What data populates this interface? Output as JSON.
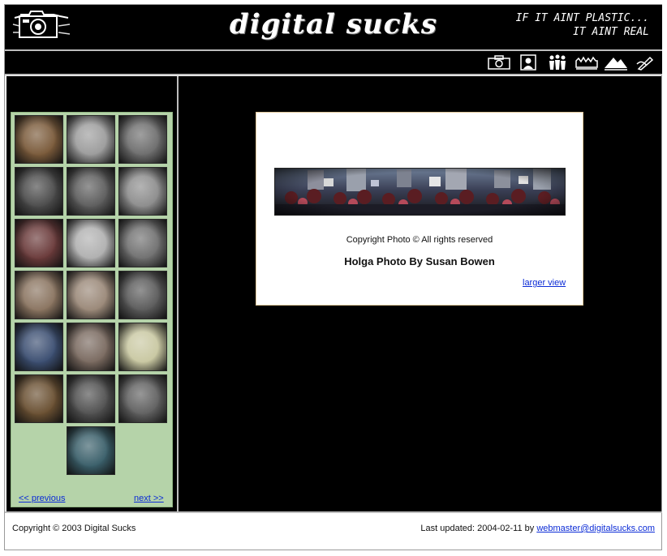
{
  "header": {
    "site_title": "digital sucks",
    "tagline_line1": "IF IT AINT PLASTIC...",
    "tagline_line2": "IT AINT REAL"
  },
  "nav_icons": [
    "camera-icon",
    "portrait-icon",
    "people-icon",
    "crowd-icon",
    "mountain-icon",
    "pen-icon"
  ],
  "sidebar": {
    "thumbnails": [
      {
        "icon": "thumbnail-photo",
        "tone": "#7a5a3a"
      },
      {
        "icon": "thumbnail-photo",
        "tone": "#9c9c9c"
      },
      {
        "icon": "thumbnail-photo",
        "tone": "#6d6d6d"
      },
      {
        "icon": "thumbnail-photo",
        "tone": "#4a4a4a"
      },
      {
        "icon": "thumbnail-photo",
        "tone": "#5c5c5c"
      },
      {
        "icon": "thumbnail-photo",
        "tone": "#8c8c8c"
      },
      {
        "icon": "thumbnail-photo",
        "tone": "#6a3a3a"
      },
      {
        "icon": "thumbnail-photo",
        "tone": "#b0b0b0"
      },
      {
        "icon": "thumbnail-photo",
        "tone": "#707070"
      },
      {
        "icon": "thumbnail-photo",
        "tone": "#8a7460"
      },
      {
        "icon": "thumbnail-photo",
        "tone": "#9a8878"
      },
      {
        "icon": "thumbnail-photo",
        "tone": "#5a5a5a"
      },
      {
        "icon": "thumbnail-photo",
        "tone": "#3c4f72"
      },
      {
        "icon": "thumbnail-photo",
        "tone": "#7a6a60"
      },
      {
        "icon": "thumbnail-photo",
        "tone": "#c9c8a2"
      },
      {
        "icon": "thumbnail-photo",
        "tone": "#6a5032"
      },
      {
        "icon": "thumbnail-photo",
        "tone": "#505050"
      },
      {
        "icon": "thumbnail-photo",
        "tone": "#606060"
      },
      {
        "icon": "thumbnail-photo",
        "tone": "#3a5f6a"
      }
    ],
    "previous_label": "<< previous",
    "next_label": "next >>"
  },
  "main": {
    "photo_copyright": "Copyright Photo © All rights reserved",
    "caption": "Holga Photo By Susan Bowen",
    "larger_view_label": "larger view"
  },
  "footer": {
    "copyright": "Copyright © 2003 Digital Sucks",
    "last_updated": "Last updated: 2004-02-11 by ",
    "email": "webmaster@digitalsucks.com"
  },
  "colors": {
    "background": "#000000",
    "sidebar_panel": "#b5d3a9",
    "link": "#0b2bd6",
    "card_border": "#e0c79a"
  }
}
